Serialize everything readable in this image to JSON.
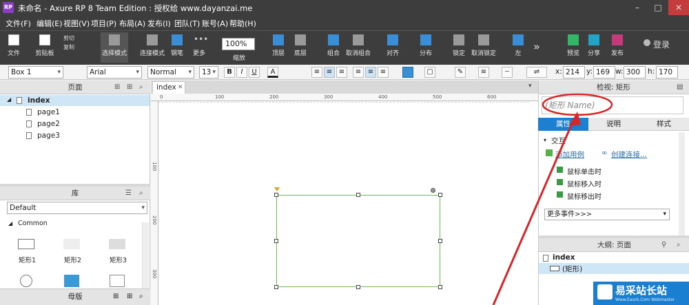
{
  "titlebar": {
    "logo": "RP",
    "title": "未命名 - Axure RP 8 Team Edition : 授权给 www.dayanzai.me",
    "buttons": [
      "–",
      "□",
      "✕"
    ]
  },
  "menu": [
    "文件(F)",
    "编辑(E)",
    "视图(V)",
    "项目(P)",
    "布局(A)",
    "发布(I)",
    "团队(T)",
    "账号(A)",
    "帮助(H)"
  ],
  "toolbar": {
    "file": "文件",
    "clipboard": "剪贴板",
    "cut": "剪切",
    "copy": "复制",
    "paste_fmt": "✂",
    "select_mode": "选择模式",
    "connect_mode": "连接模式",
    "pen": "钢笔",
    "more": "更多",
    "zoom_value": "100%",
    "zoom_label": "缩放",
    "top": "顶层",
    "bottom": "底层",
    "group": "组合",
    "ungroup": "取消组合",
    "align": "对齐",
    "distribute": "分布",
    "lock": "锁定",
    "unlock": "取消锁定",
    "left": "左",
    "expand": "»",
    "preview": "预览",
    "share": "分享",
    "publish": "发布",
    "login": "登录"
  },
  "format": {
    "widget": "Box 1",
    "font": "Arial",
    "style": "Normal",
    "size": "13",
    "bold": "B",
    "italic": "I",
    "underline": "U",
    "text_color": "A",
    "x_label": "x:",
    "x": "214",
    "y_label": "y:",
    "y": "169",
    "w_label": "w:",
    "w": "300",
    "h_label": "h:",
    "h": "170"
  },
  "pages": {
    "header": "页面",
    "root": "index",
    "items": [
      "page1",
      "page2",
      "page3"
    ]
  },
  "library": {
    "header": "库",
    "selected": "Default",
    "group": "Common",
    "widgets": [
      "矩形1",
      "矩形2",
      "矩形3"
    ]
  },
  "masters": {
    "header": "母版"
  },
  "canvas": {
    "tab": "index",
    "ruler_h": [
      "0",
      "100",
      "200",
      "300",
      "400",
      "500",
      "600"
    ],
    "ruler_v": [
      "100",
      "200",
      "300"
    ]
  },
  "inspector": {
    "header": "检视: 矩形",
    "name_placeholder": "(矩形 Name)",
    "tabs": [
      "属性",
      "说明",
      "样式"
    ],
    "section": "交互",
    "add_case": "添加用例",
    "create_link": "创建连接...",
    "events": [
      "鼠标单击时",
      "鼠标移入时",
      "鼠标移出时"
    ],
    "more_events": "更多事件>>>"
  },
  "outline": {
    "header": "大纲: 页面",
    "root": "index",
    "item": "(矩形)"
  },
  "watermark": {
    "brand": "易采站长站",
    "url": "Www.Easck.Com Webmaster"
  }
}
